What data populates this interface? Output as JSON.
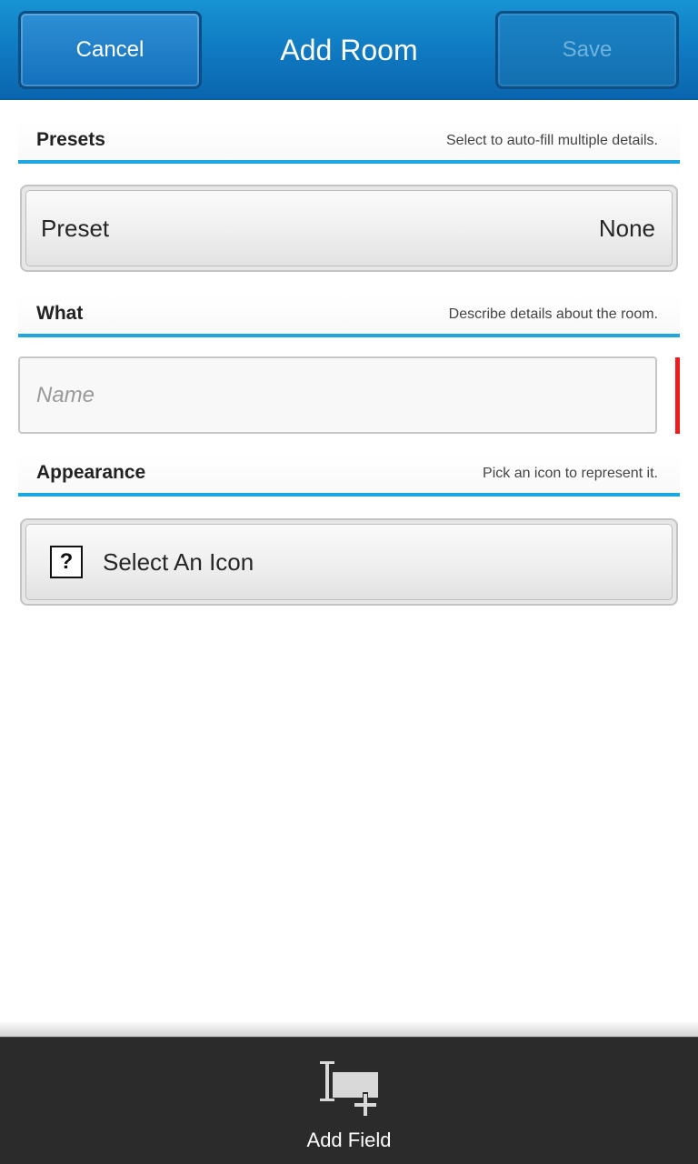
{
  "titlebar": {
    "cancel_label": "Cancel",
    "title": "Add Room",
    "save_label": "Save"
  },
  "presets": {
    "title": "Presets",
    "hint": "Select to auto-fill multiple details.",
    "preset_label": "Preset",
    "preset_value": "None"
  },
  "what": {
    "title": "What",
    "hint": "Describe details about the room.",
    "name_placeholder": "Name",
    "name_value": ""
  },
  "appearance": {
    "title": "Appearance",
    "hint": "Pick an icon to represent it.",
    "icon_glyph": "?",
    "select_icon_label": "Select An Icon"
  },
  "actionbar": {
    "add_field_label": "Add Field",
    "add_field_icon": "add-field-icon"
  },
  "colors": {
    "accent": "#1ea6df",
    "titlebar": "#0f78c0",
    "required": "#ee1c1c",
    "actionbar": "#2b2b2b"
  }
}
